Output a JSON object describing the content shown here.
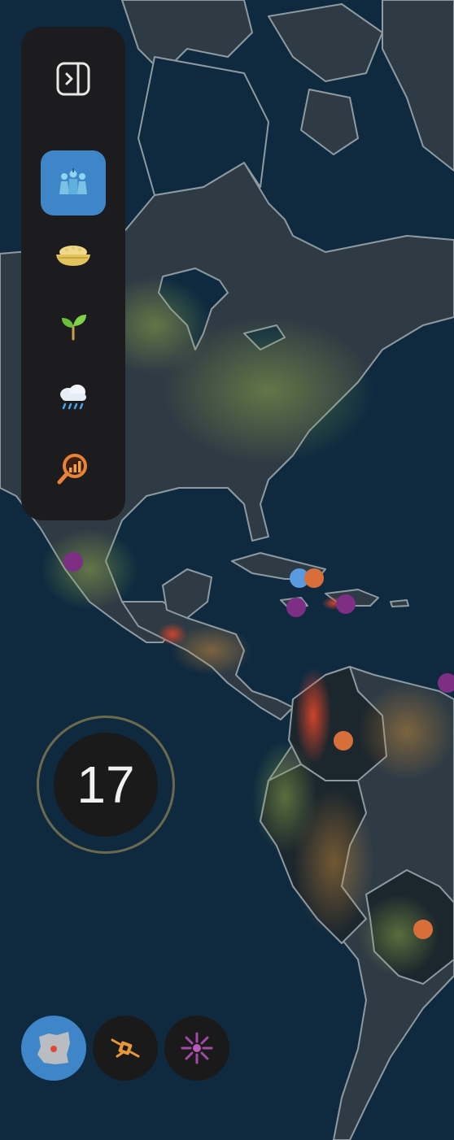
{
  "counter": {
    "value": "17"
  },
  "colors": {
    "ocean": "#0f2a3f",
    "land": "#2e3b44",
    "border": "#8e9aa1",
    "panel": "#1c1c1e",
    "accent": "#3f86c8",
    "marker_purple": "#7d2f86",
    "marker_orange": "#d86f3a",
    "marker_blue": "#5a9adf"
  },
  "sidebar": {
    "items": [
      {
        "icon": "panel-toggle-icon",
        "active": false
      },
      {
        "icon": "people-icon",
        "active": true
      },
      {
        "icon": "grain-bowl-icon",
        "active": false
      },
      {
        "icon": "seedling-icon",
        "active": false
      },
      {
        "icon": "rain-cloud-icon",
        "active": false
      },
      {
        "icon": "magnifier-chart-icon",
        "active": false
      }
    ]
  },
  "bottom_controls": [
    {
      "icon": "region-map-icon",
      "active": true
    },
    {
      "icon": "satellite-icon",
      "active": false
    },
    {
      "icon": "burst-icon",
      "active": false
    }
  ],
  "markers": [
    {
      "color": "purple"
    },
    {
      "color": "blue"
    },
    {
      "color": "orange"
    },
    {
      "color": "purple"
    },
    {
      "color": "purple"
    },
    {
      "color": "purple"
    },
    {
      "color": "orange"
    },
    {
      "color": "orange"
    }
  ]
}
